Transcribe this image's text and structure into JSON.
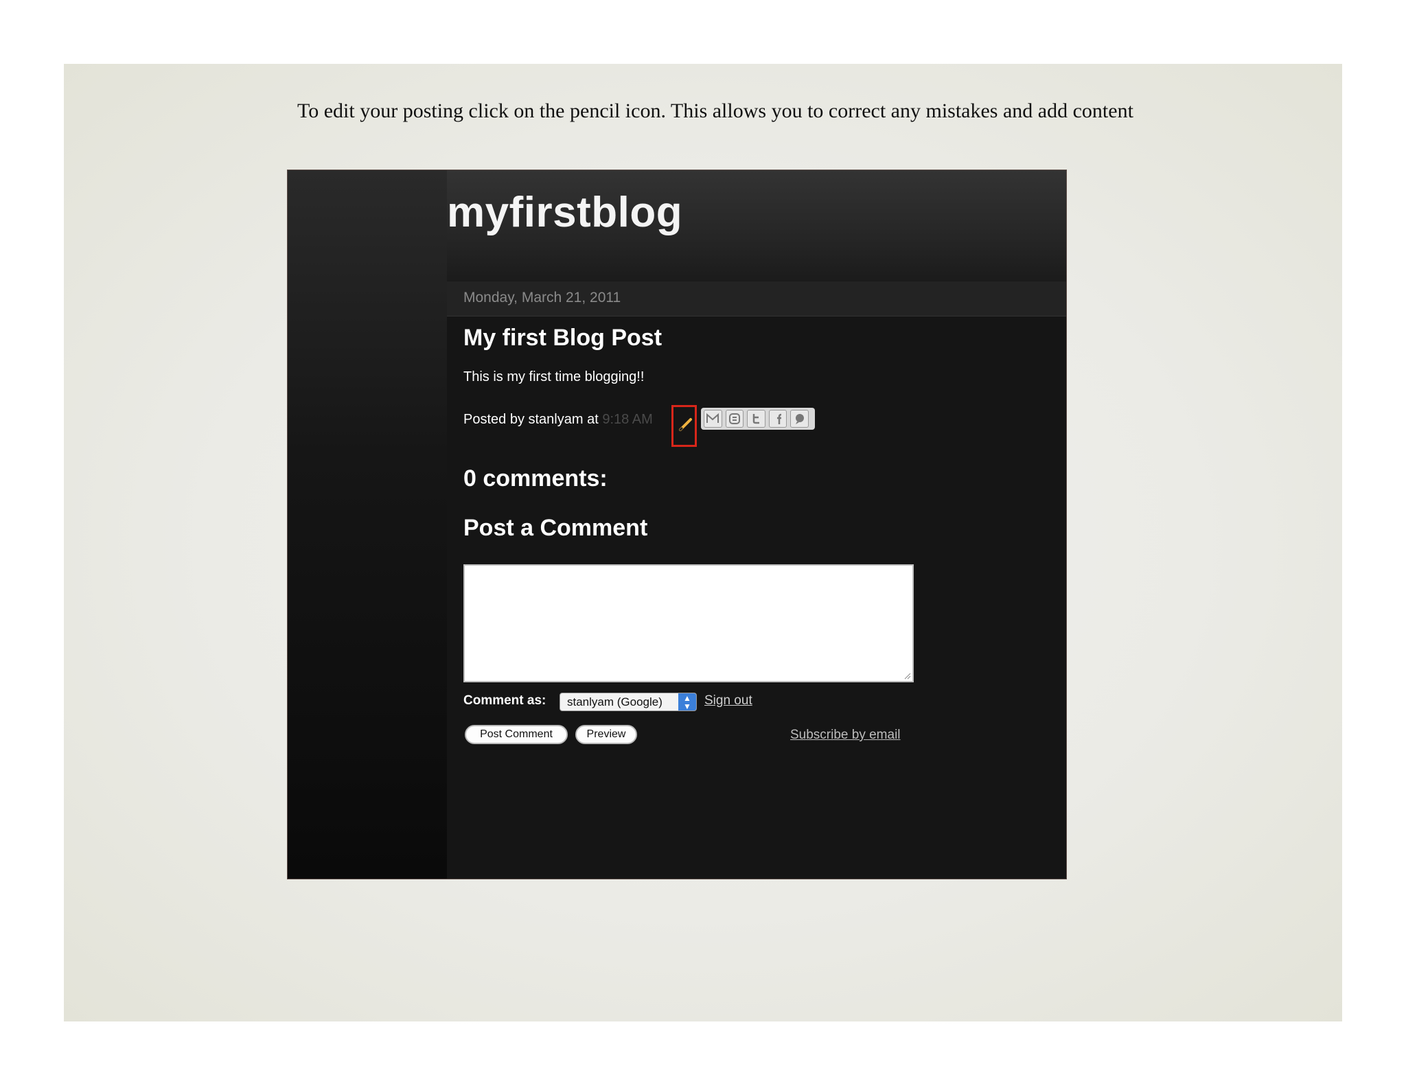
{
  "instruction": "To edit your posting click on the pencil icon. This allows you to correct any mistakes  and add content",
  "blog": {
    "title": "myfirstblog",
    "date": "Monday, March 21, 2011",
    "post_title": "My first Blog Post",
    "post_body": "This is my first time blogging!!",
    "posted_by_prefix": "Posted by stanlyam at",
    "post_time": "9:18 AM",
    "share_icons": [
      "email-icon",
      "blogger-icon",
      "twitter-icon",
      "facebook-icon",
      "buzz-icon"
    ],
    "comments_heading": "0 comments:",
    "post_comment_heading": "Post a Comment",
    "comment_as_label": "Comment as:",
    "comment_identity": "stanlyam (Google)",
    "sign_out": "Sign out",
    "post_comment_button": "Post Comment",
    "preview_button": "Preview",
    "subscribe_link": "Subscribe by email"
  },
  "colors": {
    "highlight": "#d7261a",
    "select_accent": "#3b7fd9"
  }
}
